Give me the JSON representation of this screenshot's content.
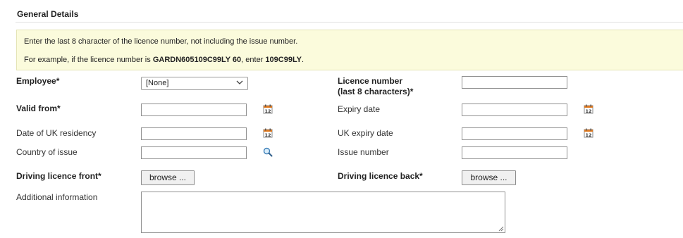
{
  "section": {
    "title": "General Details"
  },
  "info": {
    "line1": "Enter the last 8 character of the licence number, not including the issue number.",
    "line2_prefix": "For example, if the licence number is ",
    "line2_example": "GARDN605109C99LY 60",
    "line2_middle": ", enter ",
    "line2_answer": "109C99LY",
    "line2_suffix": "."
  },
  "form": {
    "employee": {
      "label": "Employee*",
      "selected": "[None]"
    },
    "licence_number": {
      "label_line1": "Licence number",
      "label_line2": "(last 8 characters)*",
      "value": ""
    },
    "valid_from": {
      "label": "Valid from*",
      "value": ""
    },
    "expiry_date": {
      "label": "Expiry date",
      "value": ""
    },
    "uk_residency": {
      "label": "Date of UK residency",
      "value": ""
    },
    "uk_expiry": {
      "label": "UK expiry date",
      "value": ""
    },
    "country_of_issue": {
      "label": "Country of issue",
      "value": ""
    },
    "issue_number": {
      "label": "Issue number",
      "value": ""
    },
    "licence_front": {
      "label": "Driving licence front*",
      "button": "browse ..."
    },
    "licence_back": {
      "label": "Driving licence back*",
      "button": "browse ..."
    },
    "additional_info": {
      "label": "Additional information",
      "value": ""
    }
  },
  "icons": {
    "calendar": "calendar-icon",
    "search": "search-icon",
    "dropdown": "chevron-down-icon"
  }
}
